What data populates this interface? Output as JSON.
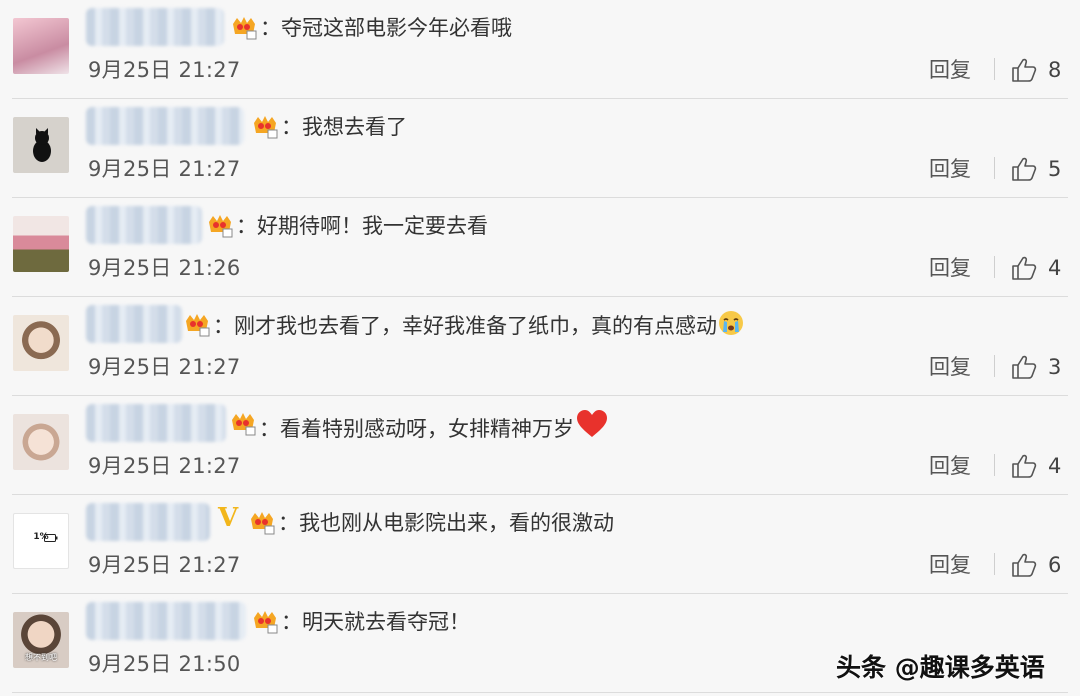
{
  "comments": [
    {
      "text": "：夺冠这部电影今年必看哦",
      "time": "9月25日 21:27",
      "reply": "回复",
      "likes": "8",
      "avatar_color": "#d9a8b8"
    },
    {
      "text": "：我想去看了",
      "time": "9月25日 21:27",
      "reply": "回复",
      "likes": "5",
      "avatar_color": "#cfcac2"
    },
    {
      "text": "：好期待啊！我一定要去看",
      "time": "9月25日 21:26",
      "reply": "回复",
      "likes": "4",
      "avatar_color": "#6b5a3e"
    },
    {
      "text": "：刚才我也去看了，幸好我准备了纸巾，真的有点感动",
      "time": "9月25日 21:27",
      "reply": "回复",
      "likes": "3",
      "avatar_color": "#d8c9b8"
    },
    {
      "text": "：看着特别感动呀，女排精神万岁",
      "time": "9月25日 21:27",
      "reply": "回复",
      "likes": "4",
      "avatar_color": "#e2d6cf"
    },
    {
      "text": "：我也刚从电影院出来，看的很激动",
      "time": "9月25日 21:27",
      "reply": "回复",
      "likes": "6",
      "avatar_color": "#ffffff",
      "avatar_text": "1%"
    },
    {
      "text": "：明天就去看夺冠！",
      "time": "9月25日 21:50",
      "reply": "回复",
      "likes": "",
      "avatar_color": "#c9c0b8",
      "avatar_text": "想不到吧"
    }
  ],
  "vip_badge": "V",
  "watermark": "头条 @趣课多英语",
  "colors": {
    "text": "#333333",
    "meta": "#555555",
    "badge": "#f2b61b",
    "heart": "#e8322c"
  }
}
